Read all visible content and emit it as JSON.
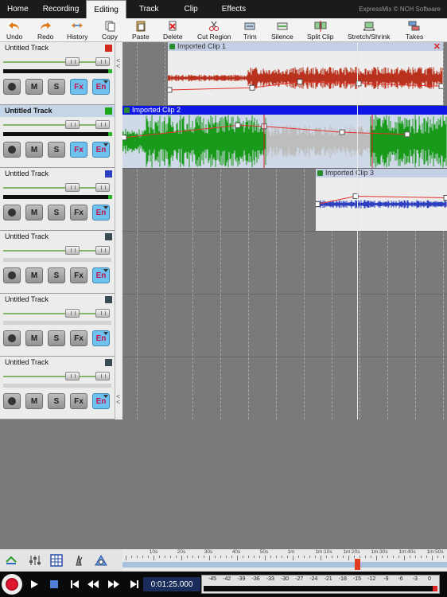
{
  "menu": {
    "tabs": [
      "Home",
      "Recording",
      "Editing",
      "Track",
      "Clip",
      "Effects"
    ],
    "active": "Editing",
    "brand": "ExpressMix © NCH Software"
  },
  "toolbar": {
    "items": [
      "Undo",
      "Redo",
      "History",
      "Copy",
      "Paste",
      "Delete",
      "Cut Region",
      "Trim",
      "Silence",
      "Split Clip",
      "Stretch/Shrink",
      "Takes"
    ]
  },
  "tracks": [
    {
      "name": "Untitled Track",
      "color": "#d32a1f",
      "selected": false,
      "fx_on": true,
      "en_on": true,
      "meter_active": true
    },
    {
      "name": "Untitled Track",
      "color": "#1aa81a",
      "selected": true,
      "fx_on": true,
      "en_on": true,
      "meter_active": true
    },
    {
      "name": "Untitled Track",
      "color": "#2b3fc0",
      "selected": false,
      "fx_on": false,
      "en_on": true,
      "meter_active": true
    },
    {
      "name": "Untitled Track",
      "color": "#3a4b52",
      "selected": false,
      "fx_on": false,
      "en_on": true,
      "meter_active": false
    },
    {
      "name": "Untitled Track",
      "color": "#3a4b52",
      "selected": false,
      "fx_on": false,
      "en_on": true,
      "meter_active": false
    },
    {
      "name": "Untitled Track",
      "color": "#3a4b52",
      "selected": false,
      "fx_on": false,
      "en_on": true,
      "meter_active": false
    }
  ],
  "track_buttons": {
    "mute": "M",
    "solo": "S",
    "fx": "Fx",
    "enable": "En"
  },
  "clips": [
    {
      "name": "Imported Clip 1",
      "track": 1,
      "wave_color": "#b8321d"
    },
    {
      "name": "Imported Clip 2",
      "track": 2,
      "wave_color": "#1a9a1a"
    },
    {
      "name": "Imported Clip 3",
      "track": 3,
      "wave_color": "#2b3fc0"
    }
  ],
  "ruler": {
    "labels": [
      "10s",
      "20s",
      "30s",
      "40s",
      "50s",
      "1m",
      "1m:10s",
      "1m:20s",
      "1m:30s",
      "1m:40s",
      "1m:50s"
    ]
  },
  "transport": {
    "time": "0:01:25.000"
  },
  "vu_meter": {
    "labels": [
      "-45",
      "-42",
      "-39",
      "-36",
      "-33",
      "-30",
      "-27",
      "-24",
      "-21",
      "-18",
      "-15",
      "-12",
      "-9",
      "-6",
      "-3",
      "0"
    ]
  }
}
